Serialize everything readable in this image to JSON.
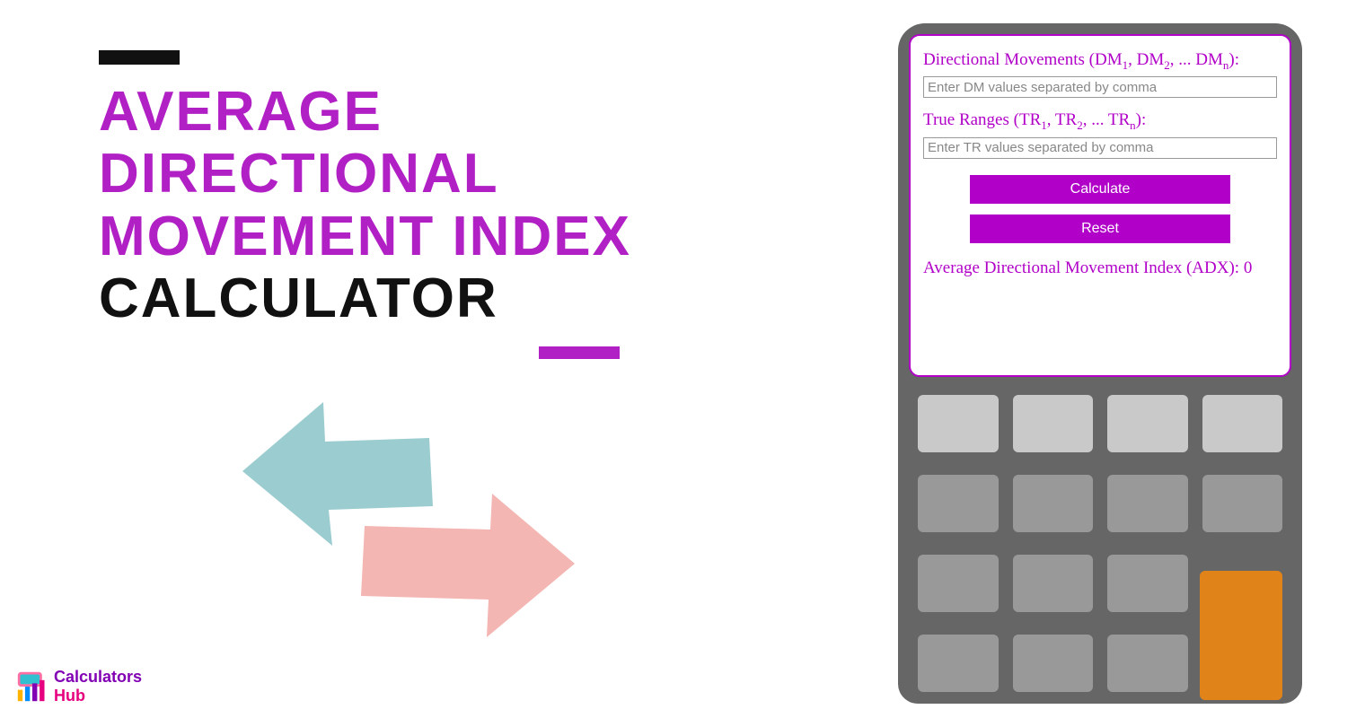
{
  "title": {
    "line1": "AVERAGE DIRECTIONAL",
    "line2": "MOVEMENT INDEX",
    "line3": "CALCULATOR"
  },
  "logo": {
    "word1": "Calculators",
    "word2": "Hub"
  },
  "form": {
    "dmLabelPrefix": "Directional Movements (DM",
    "dmLabelMid": ", DM",
    "dmLabelEnd": ", ... DM",
    "dmLabelClose": "):",
    "dmPlaceholder": "Enter DM values separated by comma",
    "trLabelPrefix": "True Ranges (TR",
    "trLabelMid": ", TR",
    "trLabelEnd": ", ... TR",
    "trLabelClose": "):",
    "trPlaceholder": "Enter TR values separated by comma",
    "calcBtn": "Calculate",
    "resetBtn": "Reset",
    "resultLabel": "Average Directional Movement Index (ADX):",
    "resultValue": "0"
  },
  "colors": {
    "purple": "#b120c4",
    "teal": "#9bcdd0",
    "pink": "#f3b6b2",
    "orange": "#e0841a"
  }
}
